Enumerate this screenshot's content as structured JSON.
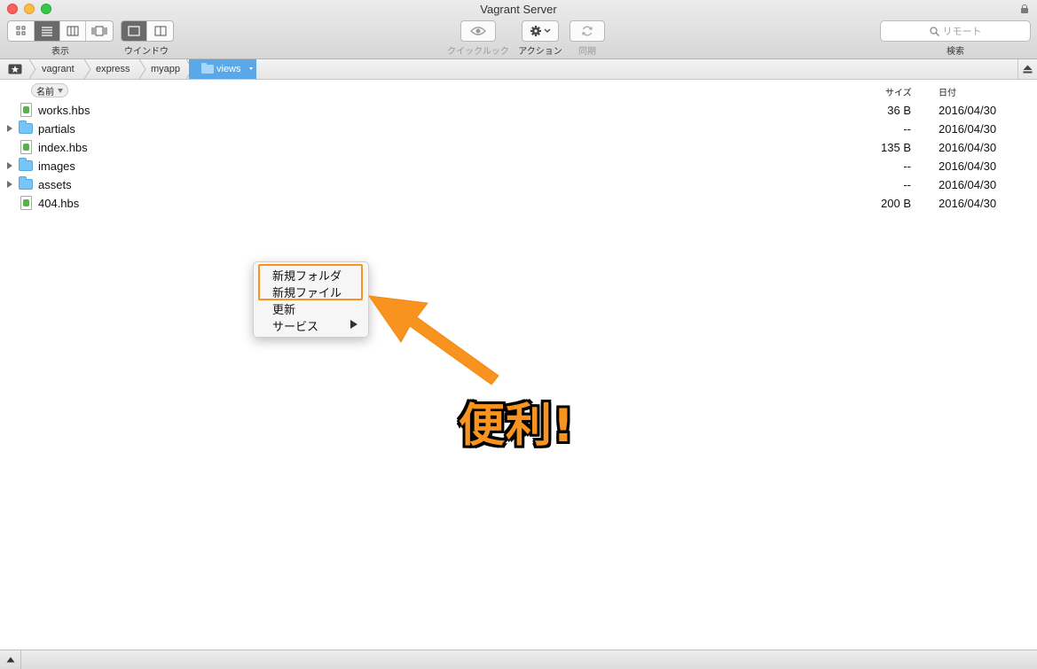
{
  "window": {
    "title": "Vagrant Server"
  },
  "toolbar": {
    "view_label": "表示",
    "window_label": "ウインドウ",
    "quicklook_label": "クイックルック",
    "action_label": "アクション",
    "sync_label": "同期",
    "search_label": "検索",
    "search_placeholder": "リモート"
  },
  "path": {
    "crumbs": [
      "vagrant",
      "express",
      "myapp",
      "views"
    ]
  },
  "columns": {
    "name": "名前",
    "size": "サイズ",
    "date": "日付"
  },
  "files": [
    {
      "name": "works.hbs",
      "size": "36 B",
      "date": "2016/04/30",
      "type": "file"
    },
    {
      "name": "partials",
      "size": "--",
      "date": "2016/04/30",
      "type": "folder"
    },
    {
      "name": "index.hbs",
      "size": "135 B",
      "date": "2016/04/30",
      "type": "file"
    },
    {
      "name": "images",
      "size": "--",
      "date": "2016/04/30",
      "type": "folder"
    },
    {
      "name": "assets",
      "size": "--",
      "date": "2016/04/30",
      "type": "folder"
    },
    {
      "name": "404.hbs",
      "size": "200 B",
      "date": "2016/04/30",
      "type": "file"
    }
  ],
  "context_menu": {
    "items": [
      "新規フォルダ",
      "新規ファイル",
      "更新",
      "サービス"
    ]
  },
  "annotation": {
    "text": "便利!",
    "color": "#f7931e"
  },
  "colors": {
    "accent": "#5aa8e8",
    "highlight": "#f7931e",
    "folder": "#77c4f7"
  }
}
